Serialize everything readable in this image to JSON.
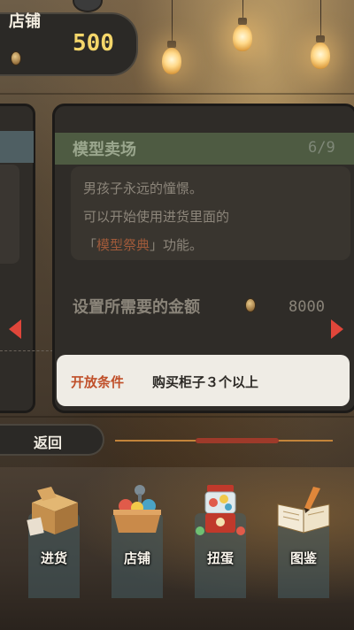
{
  "header": {
    "shop_label": "店铺",
    "money": "500"
  },
  "card": {
    "title": "模型卖场",
    "count": "6/9",
    "description_lines": [
      "男孩子永远的憧憬。",
      "可以开始使用进货里面的",
      "「",
      "模型祭典",
      "」功能。"
    ],
    "requirement_label": "设置所需要的金额",
    "requirement_value": "8000",
    "condition_label": "开放条件",
    "condition_text": "购买柜子３个以上"
  },
  "back_label": "返回",
  "progress": {
    "position": 0.6
  },
  "nav": [
    {
      "label": "进货",
      "icon": "box-icon"
    },
    {
      "label": "店铺",
      "icon": "toy-basket-icon"
    },
    {
      "label": "扭蛋",
      "icon": "gacha-machine-icon"
    },
    {
      "label": "图鉴",
      "icon": "book-icon"
    }
  ],
  "colors": {
    "accent_red": "#e0463a",
    "money_yellow": "#f4d66a",
    "condition_label": "#c0502a"
  }
}
